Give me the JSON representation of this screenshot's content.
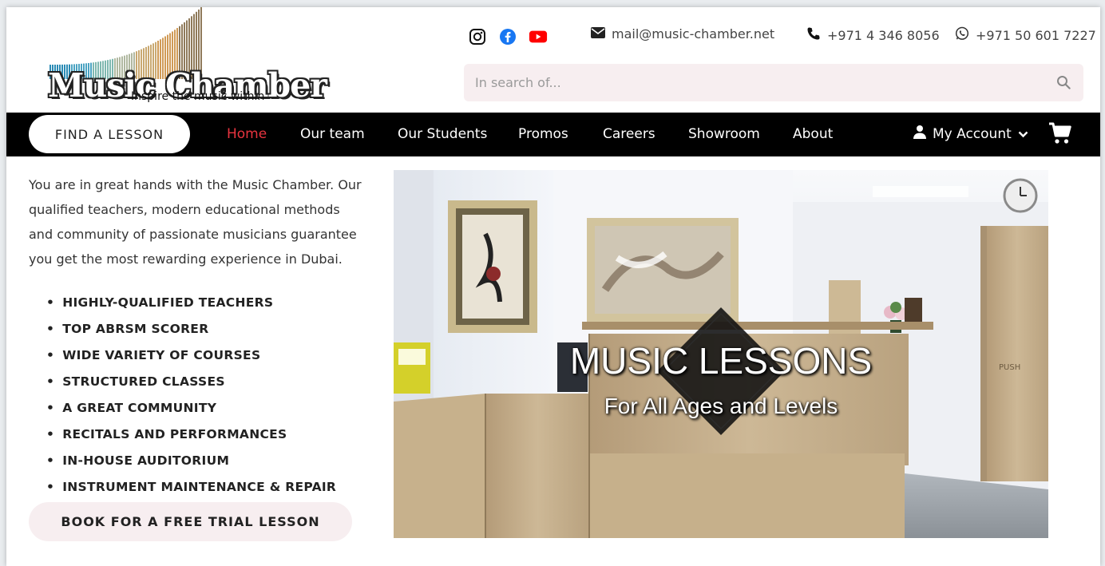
{
  "header": {
    "logo_word": "Music Chamber",
    "logo_tagline": "Inspire the music within",
    "social": [
      {
        "icon": "instagram-icon",
        "color": "#111111"
      },
      {
        "icon": "facebook-icon",
        "color": "#1877f2"
      },
      {
        "icon": "youtube-icon",
        "color": "#ff0000"
      }
    ],
    "email": "mail@music-chamber.net",
    "phone": "+971 4 346 8056",
    "whatsapp": "+971 50 601 7227",
    "search_placeholder": "In search of..."
  },
  "nav": {
    "find_lesson": "FIND A LESSON",
    "items": [
      {
        "label": "Home",
        "active": true
      },
      {
        "label": "Our team"
      },
      {
        "label": "Our Students"
      },
      {
        "label": "Promos"
      },
      {
        "label": "Careers"
      },
      {
        "label": "Showroom"
      },
      {
        "label": "About"
      }
    ],
    "account_label": "My Account",
    "active_color": "#e8343f"
  },
  "main": {
    "intro": "You are in great hands with the Music Chamber. Our qualified teachers, modern educational methods and community of passionate musicians guarantee you get the most rewarding experience in Dubai.",
    "features": [
      "HIGHLY-QUALIFIED TEACHERS",
      "TOP ABRSM SCORER",
      "WIDE VARIETY OF COURSES",
      "STRUCTURED CLASSES",
      "A GREAT COMMUNITY",
      "RECITALS AND PERFORMANCES",
      "IN-HOUSE AUDITORIUM",
      "INSTRUMENT MAINTENANCE & REPAIR"
    ],
    "trial_button": "BOOK FOR A FREE TRIAL LESSON"
  },
  "hero": {
    "title": "MUSIC LESSONS",
    "subtitle": "For All Ages and Levels",
    "door_sign": "PUSH"
  }
}
